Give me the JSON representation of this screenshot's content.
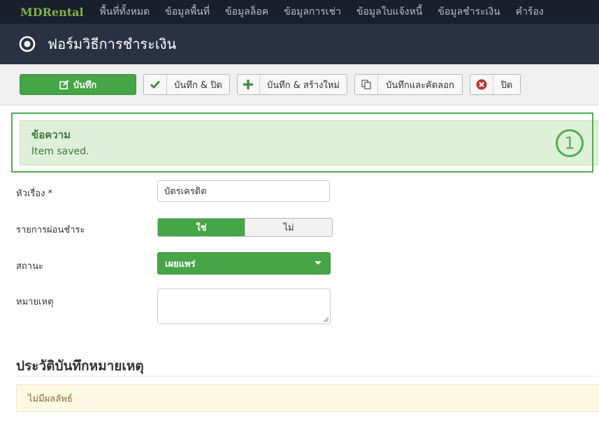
{
  "nav": {
    "brand": "MDRental",
    "items": [
      "พื้นที่ทั้งหมด",
      "ข้อมูลพื้นที่",
      "ข้อมูลล็อค",
      "ข้อมูลการเช่า",
      "ข้อมูลใบแจ้งหนี้",
      "ข้อมูลชำระเงิน",
      "คำร้อง"
    ]
  },
  "header": {
    "title": "ฟอร์มวิธีการชำระเงิน"
  },
  "toolbar": {
    "save": "บันทึก",
    "save_close": "บันทึก & ปิด",
    "save_new": "บันทึก & สร้างใหม่",
    "save_copy": "บันทึกและคัดลอก",
    "close": "ปิด"
  },
  "message": {
    "heading": "ข้อความ",
    "text": "Item saved.",
    "marker": "1"
  },
  "form": {
    "title_label": "หัวเรื่อง *",
    "title_value": "บัตรเครดิต",
    "installment_label": "รายการผ่อนชำระ",
    "yes": "ใช่",
    "no": "ไม่",
    "status_label": "สถานะ",
    "status_value": "เผยแพร่",
    "note_label": "หมายเหตุ"
  },
  "history": {
    "title": "ประวัติบันทึกหมายเหตุ",
    "empty": "ไม่มีผลลัพธ์"
  },
  "colors": {
    "success": "#46a546",
    "nav_bg": "#1b1f2b",
    "title_bg": "#2a3142",
    "brand": "#7fb24a"
  }
}
